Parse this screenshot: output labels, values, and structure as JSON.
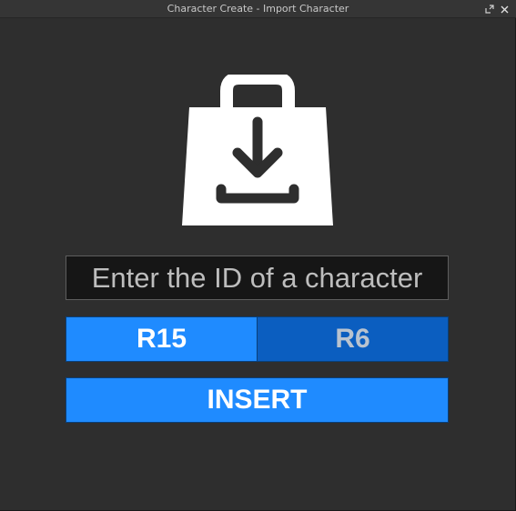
{
  "window": {
    "title": "Character Create - Import Character"
  },
  "titlebar_icons": [
    "restore-icon",
    "close-icon"
  ],
  "hero": {
    "icon": "shopping-bag-download-icon"
  },
  "id_input": {
    "placeholder": "Enter the ID of a character",
    "value": ""
  },
  "rig_toggle": {
    "options": [
      "R15",
      "R6"
    ],
    "selected": "R15"
  },
  "insert_button": {
    "label": "INSERT"
  },
  "colors": {
    "background": "#2e2e2e",
    "accent": "#1f8bff",
    "accent_dark": "#0b5ec0",
    "input_background": "#161616"
  }
}
